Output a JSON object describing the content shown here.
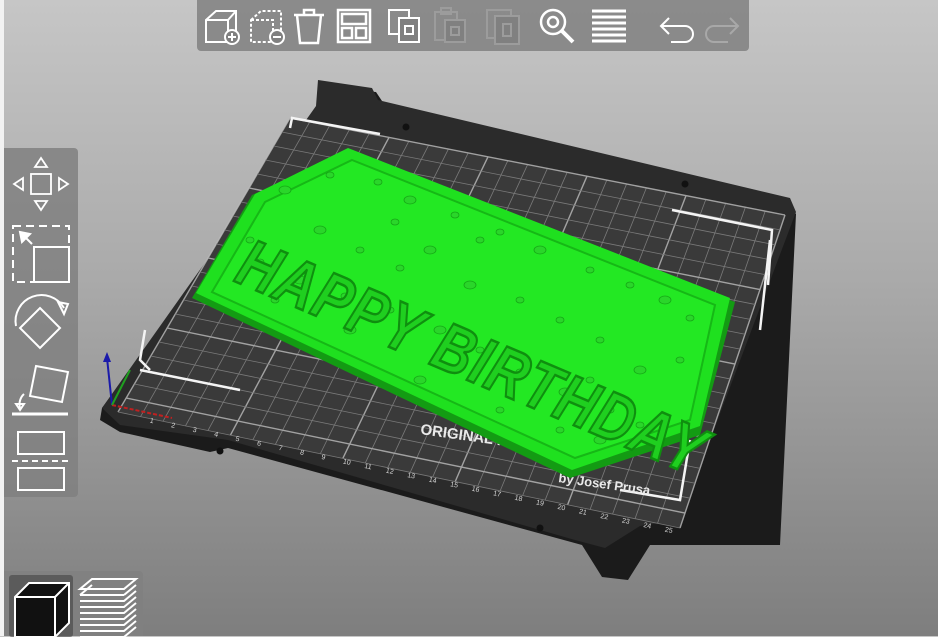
{
  "viewport": {
    "model_text": "HAPPY BIRTHDAY",
    "bed_label_line1": "ORIGINAL PRUSA i3 MK3",
    "bed_label_line2": "by Josef Prusa",
    "ruler_numbers": [
      "1",
      "2",
      "3",
      "4",
      "5",
      "6",
      "7",
      "8",
      "9",
      "10",
      "11",
      "12",
      "13",
      "14",
      "15",
      "16",
      "17",
      "18",
      "19",
      "20",
      "21",
      "22",
      "23",
      "24",
      "25"
    ]
  },
  "toolbar_top": {
    "buttons": [
      {
        "name": "add-object-button",
        "icon": "add-cube-icon",
        "enabled": true
      },
      {
        "name": "delete-button",
        "icon": "delete-cube-icon",
        "enabled": true
      },
      {
        "name": "delete-all-button",
        "icon": "trash-icon",
        "enabled": true
      },
      {
        "name": "arrange-button",
        "icon": "arrange-icon",
        "enabled": true
      },
      {
        "name": "copy-button",
        "icon": "copy-icon",
        "enabled": true
      },
      {
        "name": "paste-button",
        "icon": "paste-icon",
        "enabled": false
      },
      {
        "name": "add-instance-button",
        "icon": "instance-plus-icon",
        "enabled": false
      },
      {
        "name": "search-button",
        "icon": "search-icon",
        "enabled": true
      },
      {
        "name": "layers-editing-button",
        "icon": "layers-icon",
        "enabled": true
      },
      {
        "name": "undo-button",
        "icon": "undo-icon",
        "enabled": true
      },
      {
        "name": "redo-button",
        "icon": "redo-icon",
        "enabled": false
      }
    ]
  },
  "toolbar_left": {
    "tools": [
      {
        "name": "move-tool",
        "icon": "move-arrows-icon"
      },
      {
        "name": "scale-tool",
        "icon": "scale-icon"
      },
      {
        "name": "rotate-tool",
        "icon": "rotate-icon"
      },
      {
        "name": "place-on-face-tool",
        "icon": "place-on-face-icon"
      },
      {
        "name": "cut-tool",
        "icon": "cut-icon"
      }
    ]
  },
  "view_toggle": {
    "items": [
      {
        "name": "3d-view-button",
        "icon": "cube-view-icon",
        "active": true
      },
      {
        "name": "preview-button",
        "icon": "layers-preview-icon",
        "active": false
      }
    ]
  },
  "colors": {
    "model_green": "#1fe01f",
    "bed_black": "#262626",
    "toolbar_bg": "#808080"
  }
}
